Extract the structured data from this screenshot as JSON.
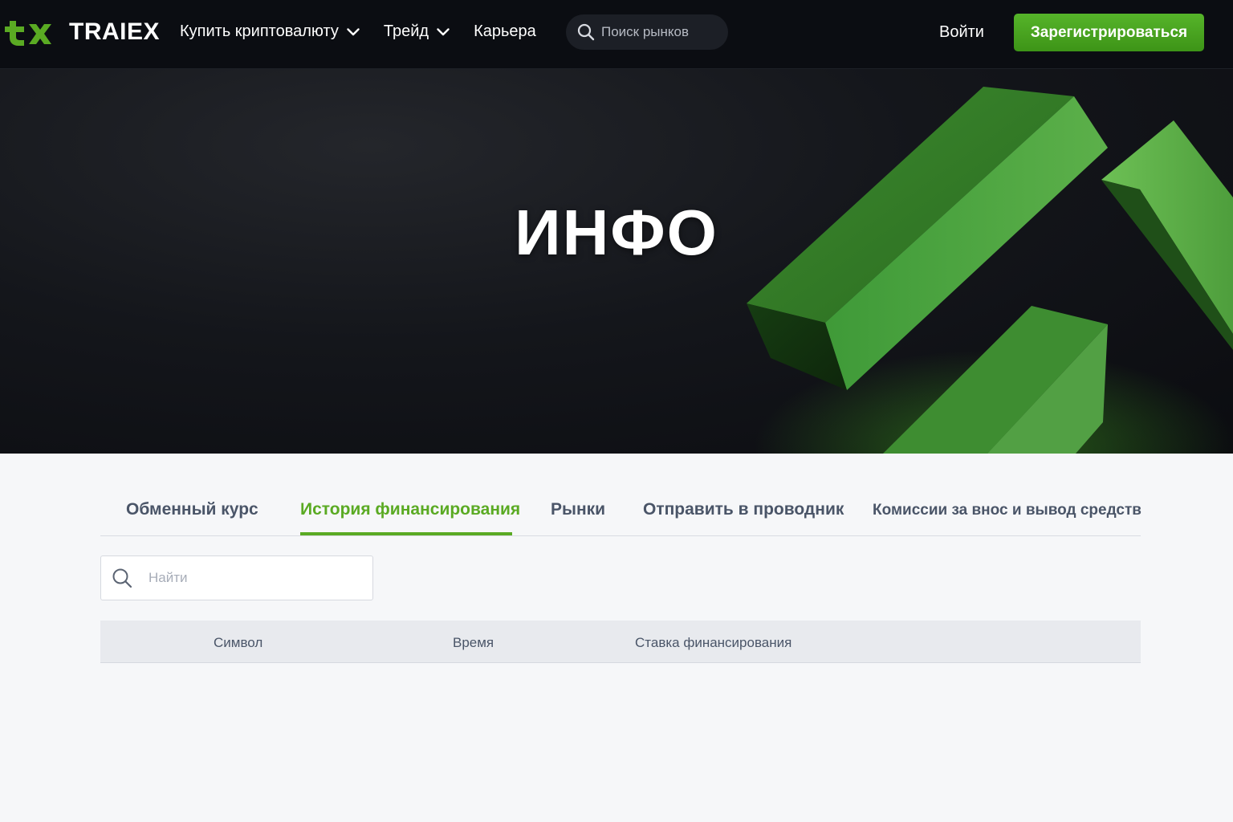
{
  "header": {
    "brand": "TRAIEX",
    "logo_icon": "tx-logo-icon",
    "nav": [
      {
        "label": "Купить криптовалюту",
        "has_dropdown": true
      },
      {
        "label": "Трейд",
        "has_dropdown": true
      },
      {
        "label": "Карьера",
        "has_dropdown": false
      }
    ],
    "search_placeholder": "Поиск рынков",
    "login_label": "Войти",
    "signup_label": "Зарегистрироваться"
  },
  "hero": {
    "title": "ИНФО"
  },
  "tabs": [
    {
      "label": "Обменный курс",
      "active": false
    },
    {
      "label": "История финансирования",
      "active": true
    },
    {
      "label": "Рынки",
      "active": false
    },
    {
      "label": "Отправить в проводник",
      "active": false
    },
    {
      "label": "Комиссии за внос и вывод средств",
      "active": false
    }
  ],
  "filter": {
    "search_placeholder": "Найти"
  },
  "table": {
    "columns": [
      "Символ",
      "Время",
      "Ставка финансирования"
    ],
    "rows": []
  },
  "colors": {
    "accent": "#5aaa23",
    "header_bg": "#0b0d12",
    "signup_bg": "#4aa620"
  }
}
